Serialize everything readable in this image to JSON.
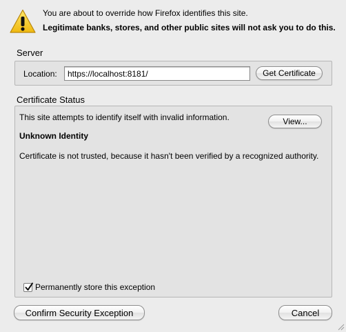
{
  "warning": {
    "icon": "warning-triangle-icon",
    "line1": "You are about to override how Firefox identifies this site.",
    "line2": "Legitimate banks, stores, and other public sites will not ask you to do this."
  },
  "server": {
    "section_label": "Server",
    "location_label": "Location:",
    "location_value": "https://localhost:8181/",
    "get_certificate_label": "Get Certificate"
  },
  "certificate_status": {
    "section_label": "Certificate Status",
    "message": "This site attempts to identify itself with invalid information.",
    "view_label": "View...",
    "issue_title": "Unknown Identity",
    "issue_detail": "Certificate is not trusted, because it hasn't been verified by a recognized authority.",
    "permanent_label": "Permanently store this exception",
    "permanent_checked": true
  },
  "actions": {
    "confirm_label": "Confirm Security Exception",
    "cancel_label": "Cancel"
  },
  "colors": {
    "background": "#ececec",
    "warning_yellow": "#f5cc1a"
  }
}
